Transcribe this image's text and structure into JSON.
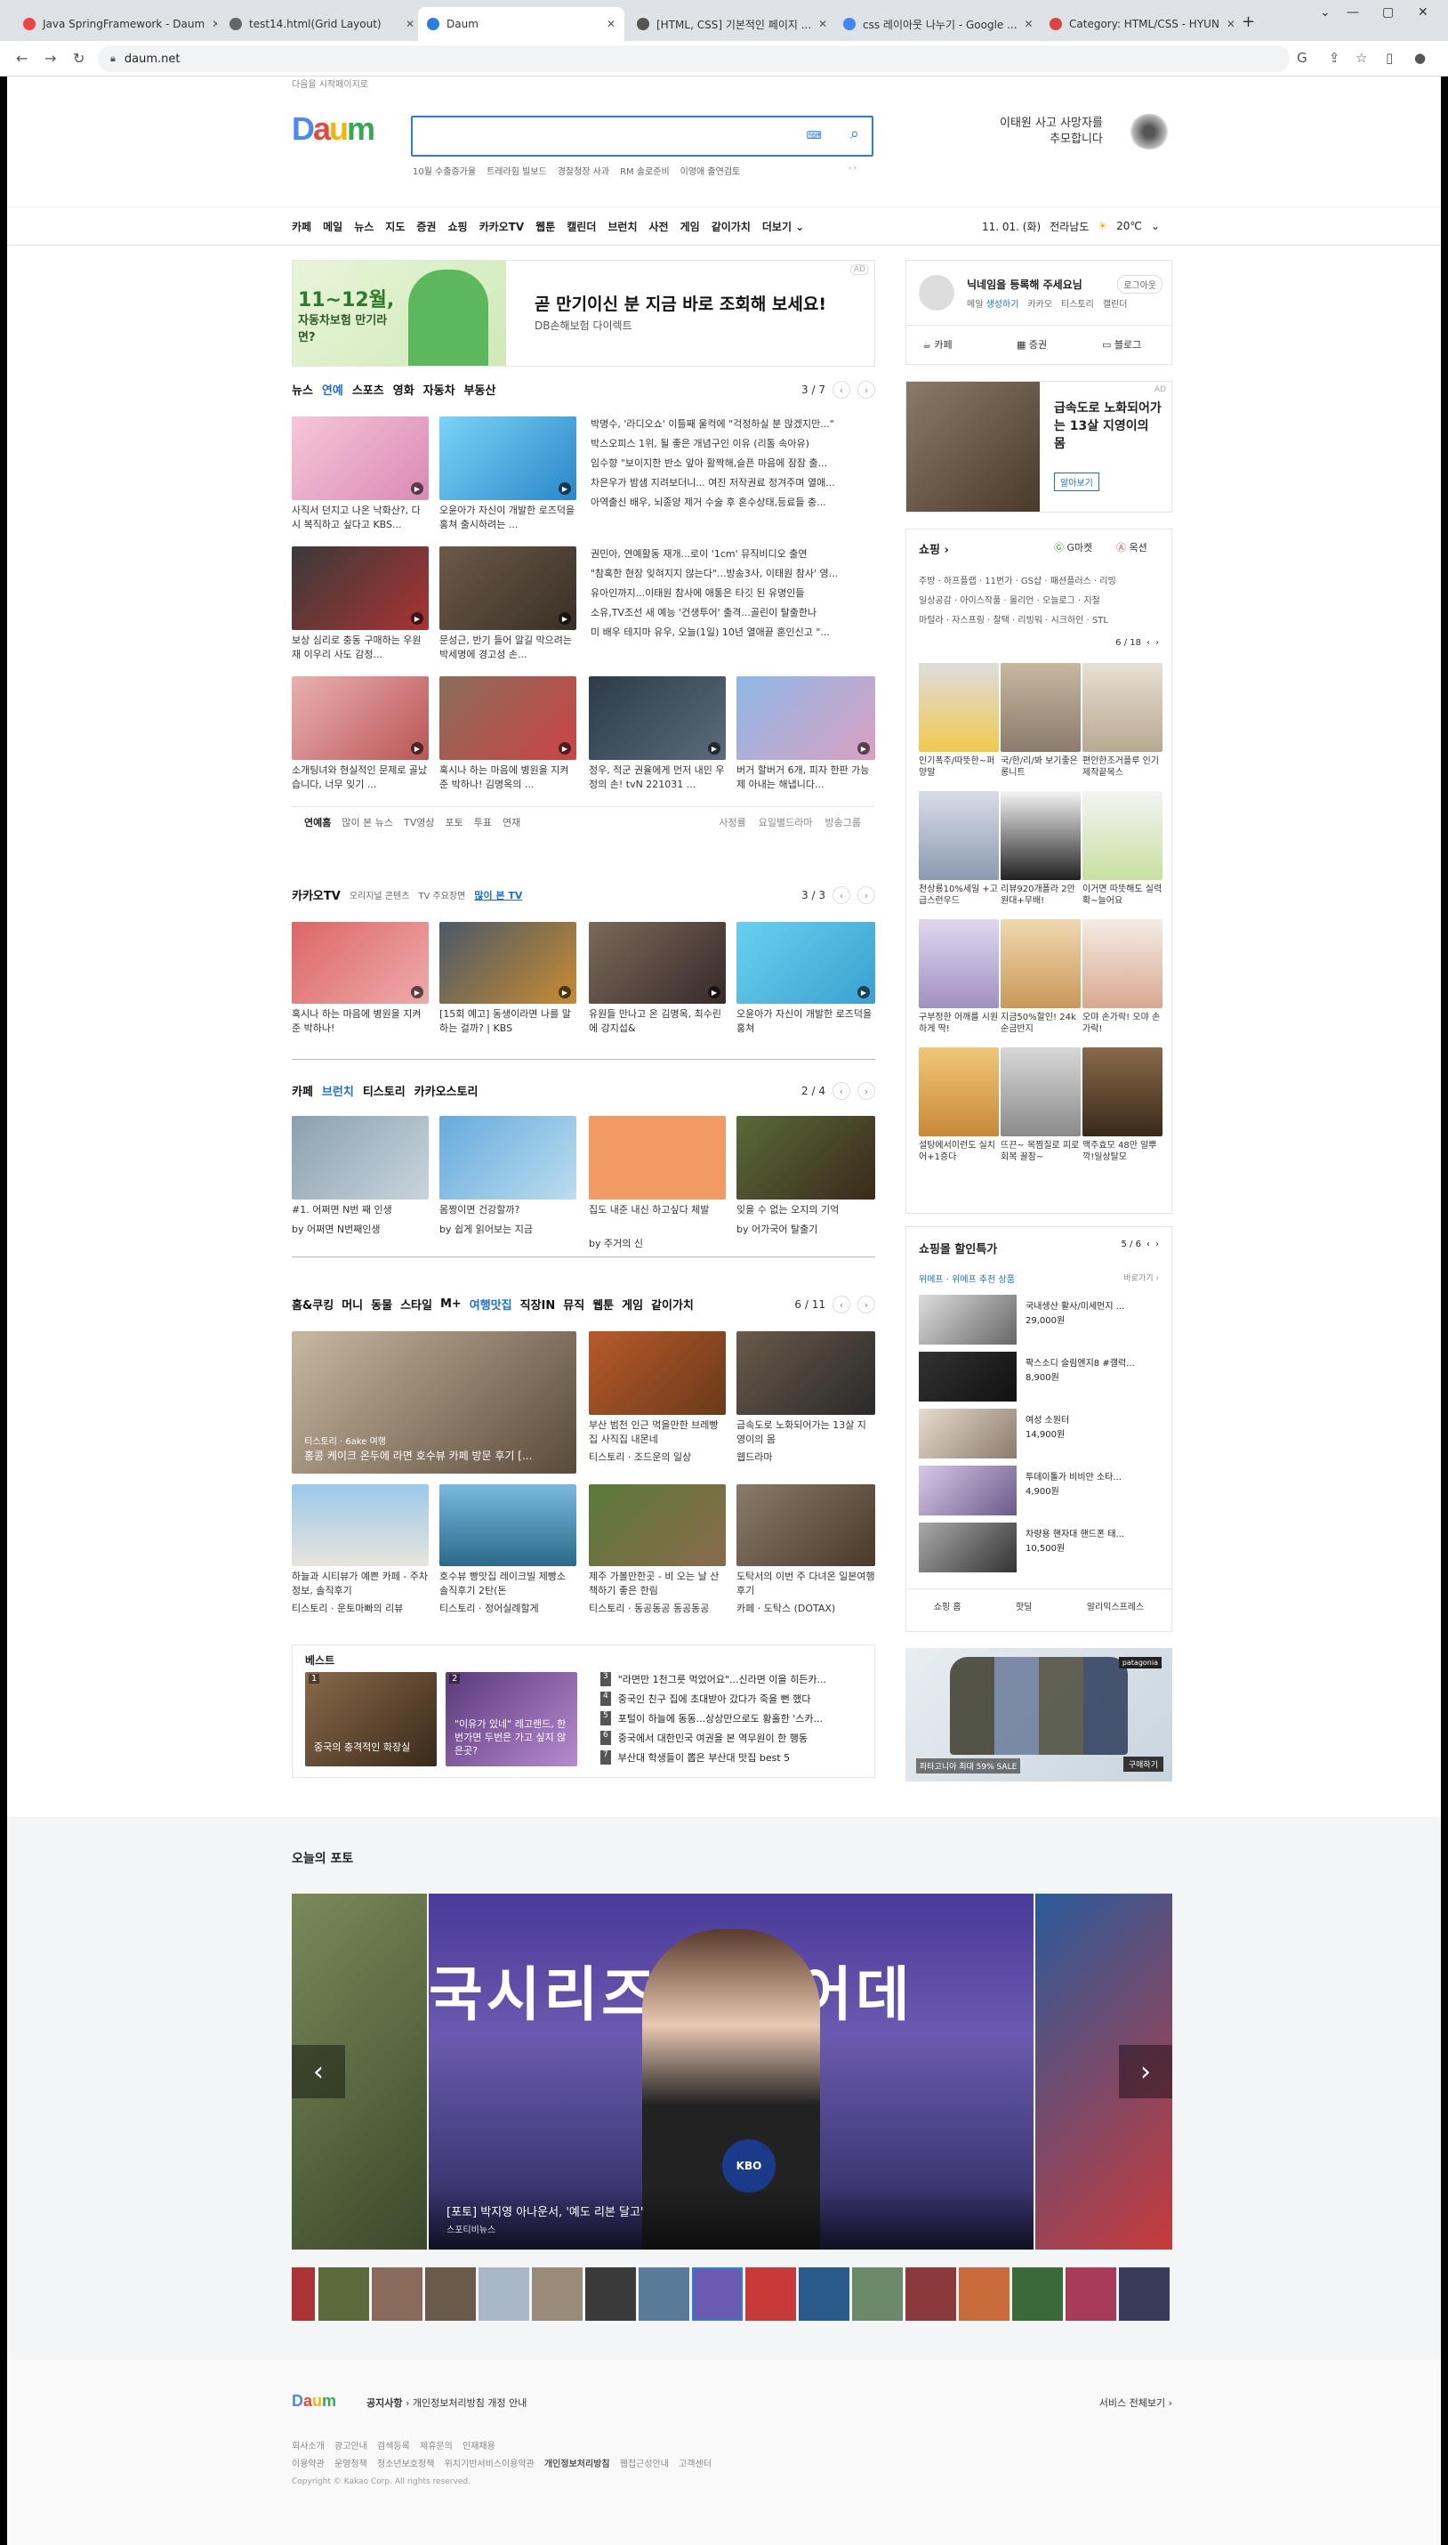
{
  "browser": {
    "tabs": [
      {
        "label": "Java SpringFramework - Daum",
        "color": "#e44"
      },
      {
        "label": "test14.html(Grid Layout)",
        "color": "#666"
      },
      {
        "label": "Daum",
        "color": "#2a7de1"
      },
      {
        "label": "[HTML, CSS] 기본적인 페이지 ...",
        "color": "#555"
      },
      {
        "label": "css 레이아웃 나누기 - Google ...",
        "color": "#4285f4"
      },
      {
        "label": "Category: HTML/CSS - HYUN",
        "color": "#d44"
      }
    ],
    "url": "daum.net"
  },
  "header": {
    "set_home": "다음을 시작페이지로",
    "logo": "Daum",
    "keywords": [
      "10월 수출증가율",
      "트레라힘 빌보드",
      "경찰청장 사과",
      "RM 솔로준비",
      "이영애 출연검토"
    ],
    "promo": [
      "이태원 사고 사망자를",
      "추모합니다"
    ]
  },
  "gnb": {
    "items": [
      "카페",
      "메일",
      "뉴스",
      "지도",
      "증권",
      "쇼핑",
      "카카오TV",
      "웹툰",
      "캘린더",
      "브런치",
      "사전",
      "게임",
      "같이가치",
      "더보기"
    ],
    "date": "11. 01. (화)",
    "region": "전라남도",
    "temp": "20℃"
  },
  "ad_banner": {
    "left_title": "11~12월,",
    "left_sub": "자동차보험 만기라면?",
    "title": "곧 만기이신 분 지금 바로 조회해 보세요!",
    "sub": "DB손해보험 다이렉트",
    "badge": "AD"
  },
  "news": {
    "tabs": [
      "뉴스",
      "연예",
      "스포츠",
      "영화",
      "자동차",
      "부동산"
    ],
    "page": "3 / 7",
    "thumbs": [
      {
        "cap": "사직서 던지고 나온 낙화산?, 다시 복직하고 싶다고 KBS..."
      },
      {
        "cap": "오윤아가 자신이 개발한 로즈덕을 홍쳐 출시하려는 ..."
      },
      {
        "cap": "보상 심리로 충동 구매하는 우원재 이우리 사도 감정..."
      },
      {
        "cap": "문성근, 반기 들어 알길 막으려는 박세명에 경고성 손..."
      },
      {
        "cap": "소개팅녀와 현실적인 문제로 골났습니다, 너무 잊기 ..."
      },
      {
        "cap": "혹시나 하는 마음에 병원을 지켜준 박하나! 김명옥의 ..."
      },
      {
        "cap": "정우, 적군 권율에게 먼저 내민 우정의 손! tvN 221031 ..."
      },
      {
        "cap": "버거 할버거 6개, 피자 한판 가능 제 아내는 해냅니다..."
      }
    ],
    "headlines": [
      "박명수, '라디오쇼' 이틀째 울컥에 \"걱정하실 분 많겠지만...\"",
      "박스오피스 1위, 될 좋은 개념구인 이유 (리톨 속아유)",
      "임수향 \"보이지한 반소 앞아 활짝해,슬픈 마음에 잠잠 출...",
      "차은우가 밤샘 지려보더니... 여진 저작권료 정겨주며 열애...",
      "아역출신 배우, 뇌종양 제거 수술 후 혼수상태,등료들 충...",
      "권민아, 연예활동 재개...로이 '1cm' 뮤직비디오 출연",
      "\"참혹한 현장 잊혀지지 않는다\"...방송3사, 이태원 참사' 영...",
      "유아인까지...이태원 참사에 애통은 타깃 된 유명인들",
      "소유,TV조선 새 예능 '건생투어' 출격...골린이 탈출한나",
      "미 배우 테지마 유우, 오늘(1일) 10년 열애끝 혼인신고 \"..."
    ],
    "subnav": [
      "연예홈",
      "많이 본 뉴스",
      "TV영상",
      "포토",
      "투표",
      "연재"
    ],
    "subnav_right": [
      "사정률",
      "요일별드라마",
      "방송그룹"
    ]
  },
  "kakaotv": {
    "title": "카카오TV",
    "tabs": [
      "오리지널 콘텐츠",
      "TV 주요장면",
      "많이 본 TV"
    ],
    "page": "3 / 3",
    "items": [
      {
        "cap": "혹시나 하는 마음에 병원을 지켜준 박하나!"
      },
      {
        "cap": "[15회 예고] 동생이라면 나를 말하는 걸까? | KBS"
      },
      {
        "cap": "유원들 만나고 온 김명옥, 최수린에 강지섭&"
      },
      {
        "cap": "오윤아가 자신이 개발한 로즈덕을 홍쳐"
      }
    ]
  },
  "brunch": {
    "tabs": [
      "카페",
      "브런치",
      "티스토리",
      "카카오스토리"
    ],
    "page": "2 / 4",
    "items": [
      {
        "cap": "#1. 어쩌면 N번 째 인생",
        "src": "by 어쩌면 N번째인생"
      },
      {
        "cap": "몸짱이면 건강할까?",
        "src": "by 쉽게 읽어보는 지금"
      },
      {
        "cap": "집도 내준 내신 하고싶다 체발",
        "src": "by 주거의 신"
      },
      {
        "cap": "잊을 수 없는 오지의 기억",
        "src": "by 어가국어 탈출기"
      }
    ]
  },
  "life": {
    "tabs": [
      "홈&쿠킹",
      "머니",
      "동물",
      "스타일",
      "M+",
      "여행맛집",
      "직장IN",
      "뮤직",
      "웹툰",
      "게임",
      "같이가치"
    ],
    "page": "6 / 11",
    "main_cap": "홍콩 케이크 온두에 라면 호수뷰 카페 방문 후기 [...",
    "main_src": "티스토리 · 6ake 여행",
    "items": [
      {
        "cap": "부산 범천 인근 먹을만한 브레빵집 사직집 내몬네",
        "src": "티스토리 · 조드운의 일상"
      },
      {
        "cap": "급속도로 노화되어가는 13살 지영이의 몸",
        "src": "웹드라마"
      },
      {
        "cap": "하늘과 시티뷰가 예쁜 카페 - 주차정보, 솔직후기",
        "src": "티스토리 · 운토마빠의 리뷰"
      },
      {
        "cap": "호수뷰 빵맛집 레이크빌 제빵소 솔직후기 2탄(돈",
        "src": "티스토리 · 정어실례할게"
      },
      {
        "cap": "제주 가볼만한곳 - 비 오는 날 산책하기 좋은 한림",
        "src": "티스토리 · 동공동공 동공동공"
      },
      {
        "cap": "도탁서의 이번 주 다녀온 일본여행 후기",
        "src": "카페 · 도탁스 (DOTAX)"
      }
    ]
  },
  "best": {
    "title": "베스트",
    "cards": [
      {
        "num": "1",
        "cap": "중국의 충격적인 화장실"
      },
      {
        "num": "2",
        "cap": "\"이유가 있네\" 레고랜드, 한번가면 두번은 가고 싶지 않은곳?"
      }
    ],
    "list": [
      {
        "num": "3",
        "text": "\"라면만 1천그릇 먹었어요\"...신라면 이을 히든카..."
      },
      {
        "num": "4",
        "text": "중국인 친구 집에 초대받아 갔다가 죽을 뻔 했다"
      },
      {
        "num": "5",
        "text": "포털이 하늘에 동동...상상만으로도 황홀한 '스카..."
      },
      {
        "num": "6",
        "text": "중국에서 대한민국 여권을 본 역무원이 한 행동"
      },
      {
        "num": "7",
        "text": "부산대 학생들이 뽑은 부산대 맛집 best 5"
      }
    ]
  },
  "login": {
    "msg": "닉네임을 등록해 주세요님",
    "logout": "로그아웃",
    "links": [
      "메일",
      "카카오",
      "티스토리",
      "캘린더"
    ],
    "quick": [
      "카페",
      "증권",
      "블로그"
    ],
    "mail_sub": "생성하기"
  },
  "side_ad": {
    "text": "급속도로 노화되어가는 13살 지영이의 몸",
    "btn": "알아보기",
    "badge": "AD"
  },
  "shopping": {
    "title": "쇼핑",
    "g": "G마켓",
    "a": "옥션",
    "cats": [
      "주방 · 하프플랩 · 11번가 · GS샵 · 패션플러스 · 리빙",
      "일상공감 · 아이스작풀 · 몰리언 · 오늘로그 · 지철",
      "마털라 · 자스프링 · 찰택 · 리빙워 · 시크하인 · STL"
    ],
    "page": "6 / 18",
    "items": [
      "인기폭주/따뜻한~퍼양말",
      "국/한/리/봐 보기좋은 롱니트",
      "편안한조거플루 인기제작끝목스",
      "천상룡10%세일 +고급스런우드",
      "리뷰920개폴라 2만원대+무배!",
      "이거면 따뜻해도 실력 확~늘어요",
      "구부정한 어깨를 시원하게 딱!",
      "지금50%할인! 24k순금반지",
      "오먀 손가락! 오먀 손가락!",
      "설탕에서이런도 실치어+1증다",
      "뜨끈~ 목찜질로 피로회복 꿀잠~",
      "맥주효모 48만 알뿌깍!일상탈모"
    ]
  },
  "discount": {
    "title": "쇼핑몰 할인특가",
    "page": "5 / 6",
    "sub": "위메프 · 위메프 추천 상품",
    "more": "바로가기",
    "items": [
      {
        "name": "국내생산 활사/미세먼지 ...",
        "price": "29,000원"
      },
      {
        "name": "팍스소디 슬림엔지8 #갤럭...",
        "price": "8,900원"
      },
      {
        "name": "여성 소원터",
        "price": "14,900원"
      },
      {
        "name": "투데이톨가 비비안 소타...",
        "price": "4,900원"
      },
      {
        "name": "차량용 핸자대 핸드폰 태...",
        "price": "10,500원"
      }
    ],
    "tabs": [
      "쇼핑 홈",
      "핫딜",
      "알리익스프레스"
    ]
  },
  "patagonia": {
    "text": "파타고니아 최대 59% SALE",
    "btn": "구매하기",
    "logo": "patagonia"
  },
  "photo": {
    "title": "오늘의 포토",
    "caption": "[포토] 박지영 아나운서, '예도 리본 달고'",
    "source": "스포티비뉴스",
    "big_text": "국시리즈 미디어데"
  },
  "footer": {
    "notice_label": "공지사항",
    "notice": "개인정보처리방침 개정 안내",
    "all_services": "서비스 전체보기",
    "links1": [
      "회사소개",
      "광고안내",
      "검색등록",
      "제휴문의",
      "인재채용"
    ],
    "links2": [
      "이용약관",
      "운영정책",
      "청소년보호정책",
      "위치기반서비스이용약관",
      "개인정보처리방침",
      "웹접근성안내",
      "고객센터"
    ],
    "copy": "Copyright © Kakao Corp. All rights reserved."
  }
}
